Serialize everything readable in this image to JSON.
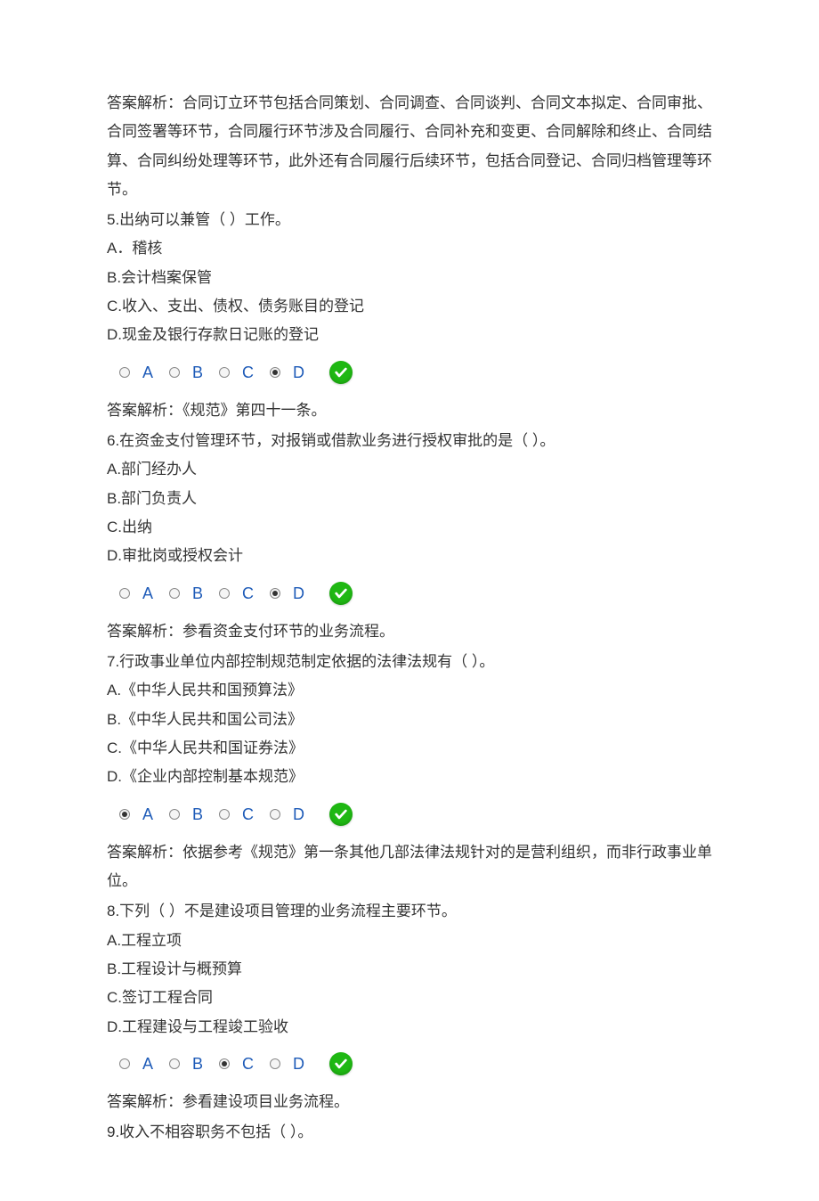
{
  "q4": {
    "explanation": "答案解析：合同订立环节包括合同策划、合同调查、合同谈判、合同文本拟定、合同审批、合同签署等环节，合同履行环节涉及合同履行、合同补充和变更、合同解除和终止、合同结算、合同纠纷处理等环节，此外还有合同履行后续环节，包括合同登记、合同归档管理等环节。"
  },
  "q5": {
    "text": "5.出纳可以兼管（ ）工作。",
    "optA": "A．稽核",
    "optB": "B.会计档案保管",
    "optC": "C.收入、支出、债权、债务账目的登记",
    "optD": "D.现金及银行存款日记账的登记",
    "labelA": "A",
    "labelB": "B",
    "labelC": "C",
    "labelD": "D",
    "explanation": "答案解析：《规范》第四十一条。"
  },
  "q6": {
    "text": "6.在资金支付管理环节，对报销或借款业务进行授权审批的是（ ）。",
    "optA": "A.部门经办人",
    "optB": "B.部门负责人",
    "optC": "C.出纳",
    "optD": "D.审批岗或授权会计",
    "labelA": "A",
    "labelB": "B",
    "labelC": "C",
    "labelD": "D",
    "explanation": "答案解析：参看资金支付环节的业务流程。"
  },
  "q7": {
    "text": "7.行政事业单位内部控制规范制定依据的法律法规有（ ）。",
    "optA": "A.《中华人民共和国预算法》",
    "optB": "B.《中华人民共和国公司法》",
    "optC": "C.《中华人民共和国证券法》",
    "optD": "D.《企业内部控制基本规范》",
    "labelA": "A",
    "labelB": "B",
    "labelC": "C",
    "labelD": "D",
    "explanation": "答案解析：依据参考《规范》第一条其他几部法律法规针对的是营利组织，而非行政事业单位。"
  },
  "q8": {
    "text": "8.下列（ ）不是建设项目管理的业务流程主要环节。",
    "optA": "A.工程立项",
    "optB": "B.工程设计与概预算",
    "optC": "C.签订工程合同",
    "optD": "D.工程建设与工程竣工验收",
    "labelA": "A",
    "labelB": "B",
    "labelC": "C",
    "labelD": "D",
    "explanation": "答案解析：参看建设项目业务流程。"
  },
  "q9": {
    "text": "9.收入不相容职务不包括（ ）。"
  }
}
